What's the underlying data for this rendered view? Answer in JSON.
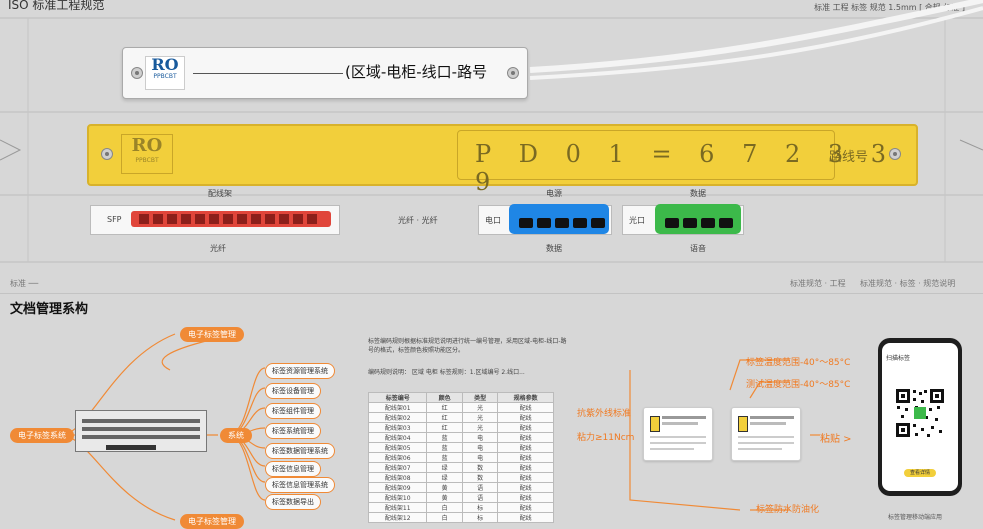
{
  "header": {
    "title": "ISO 标准工程规范",
    "right_note": "标准 工程 标签 规范  1.5mm  [ 合规  标准 ]"
  },
  "white_label": {
    "logo_top": "RO",
    "logo_bottom": "PPBCBT",
    "text": "(区域-电柜-线口-路号"
  },
  "yellow_label": {
    "logo_top": "RO",
    "logo_bottom": "PPBCBT",
    "code": "P  D  0  1  =  6  7  2  3  3  9",
    "suffix": "路线号"
  },
  "ports": {
    "red": {
      "top_caption": "配线架",
      "left_tag": "SFP",
      "bottom_caption": "光纤"
    },
    "middle_text": "光纤 · 光纤",
    "blue": {
      "top_caption": "电源",
      "left_tag": "电口",
      "bottom_caption": "数据"
    },
    "green": {
      "top_caption": "数据",
      "left_tag": "光口",
      "bottom_caption": "语音"
    }
  },
  "footer_notes": {
    "left": "标准 ──",
    "right_a": "标准规范 · 工程",
    "right_b": "标准规范 · 标签 · 规范说明"
  },
  "section_title": "文档管理系构",
  "mind": {
    "root": "电子标签系统",
    "top": "电子标签管理",
    "bottom": "电子标签管理",
    "center": "系统",
    "nodes": [
      "标签资源管理系统",
      "标签设备管理",
      "标签组件管理",
      "标签系统管理",
      "标签数据管理系统",
      "标签信息管理",
      "标签信息管理系统",
      "标签数据导出"
    ]
  },
  "doc": {
    "para": "标签编码规则根据标准规范说明进行统一编号管理，采用区域-电柜-线口-路号的格式，标签颜色按照功能区分。",
    "legend": "编码规则说明：  区域 电柜  标签规则：1.区域编号 2.线口...",
    "table": {
      "headers": [
        "标签编号",
        "颜色",
        "类型",
        "规格参数"
      ],
      "rows": [
        [
          "配线架01",
          "红",
          "光",
          "配线"
        ],
        [
          "配线架02",
          "红",
          "光",
          "配线"
        ],
        [
          "配线架03",
          "红",
          "光",
          "配线"
        ],
        [
          "配线架04",
          "蓝",
          "电",
          "配线"
        ],
        [
          "配线架05",
          "蓝",
          "电",
          "配线"
        ],
        [
          "配线架06",
          "蓝",
          "电",
          "配线"
        ],
        [
          "配线架07",
          "绿",
          "数",
          "配线"
        ],
        [
          "配线架08",
          "绿",
          "数",
          "配线"
        ],
        [
          "配线架09",
          "黄",
          "语",
          "配线"
        ],
        [
          "配线架10",
          "黄",
          "语",
          "配线"
        ],
        [
          "配线架11",
          "白",
          "标",
          "配线"
        ],
        [
          "配线架12",
          "白",
          "标",
          "配线"
        ]
      ]
    }
  },
  "specs": {
    "temp1": "标签温度范围-40°～85°C",
    "temp2": "测试温度范围-40°～85°C",
    "left1": "抗紫外线标准",
    "left2": "粘力≥11Ncm",
    "right": "粘贴 >",
    "bottom": "标签防水防油化"
  },
  "phone": {
    "title": "扫描标签",
    "button": "查看详情",
    "caption": "标签管理移动端应用"
  },
  "colors": {
    "yellow": "#f2cf3b",
    "red": "#e0453a",
    "blue": "#1f86e5",
    "green": "#3cb94a",
    "orange": "#f08a36"
  }
}
